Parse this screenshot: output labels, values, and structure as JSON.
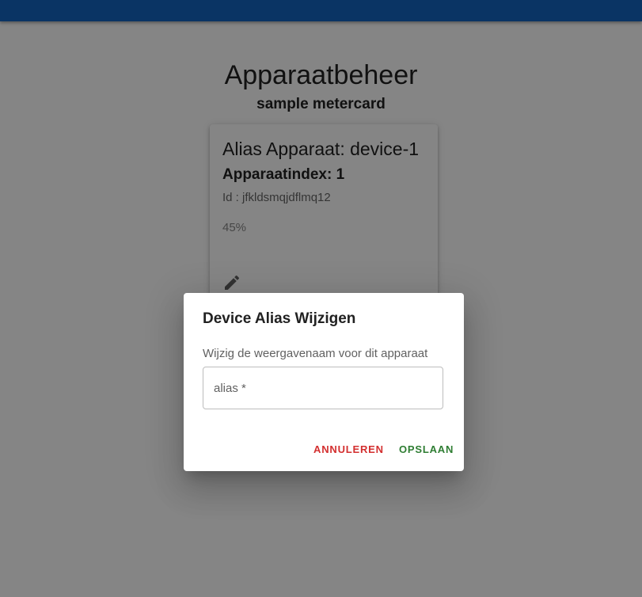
{
  "page": {
    "title": "Apparaatbeheer",
    "subtitle": "sample metercard"
  },
  "device_card": {
    "alias_title": "Alias Apparaat: device-1",
    "index": "Apparaatindex: 1",
    "id": "Id : jfkldsmqjdflmq12",
    "progress": "45%",
    "edit_icon": "pencil-icon"
  },
  "dialog": {
    "title": "Device Alias Wijzigen",
    "text": "Wijzig de weergavenaam voor dit apparaat",
    "alias_label": "alias *",
    "alias_value": "",
    "cancel_label": "ANNULEREN",
    "save_label": "OPSLAAN"
  },
  "colors": {
    "appbar": "#1565c0",
    "cancel": "#d32f2f",
    "save": "#2e7d32"
  }
}
